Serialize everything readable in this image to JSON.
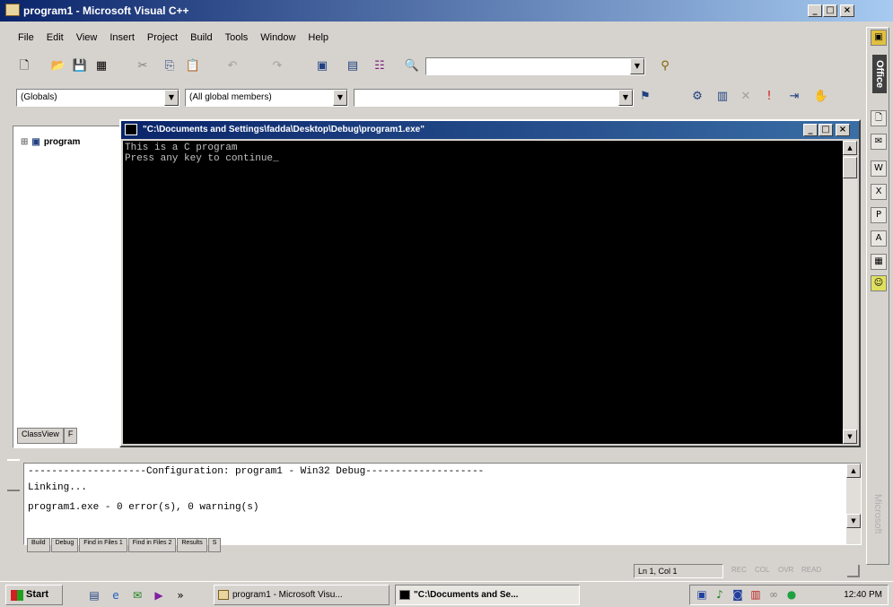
{
  "window": {
    "title": "program1 - Microsoft Visual C++",
    "controls": [
      "_",
      "□",
      "×"
    ]
  },
  "menu": [
    "File",
    "Edit",
    "View",
    "Insert",
    "Project",
    "Build",
    "Tools",
    "Window",
    "Help"
  ],
  "combos": {
    "scope": "(Globals)",
    "members": "(All global members)",
    "function": ""
  },
  "workspace": {
    "tree_root": "program",
    "tabs": [
      "ClassView",
      "F"
    ]
  },
  "console": {
    "title": "\"C:\\Documents and Settings\\fadda\\Desktop\\Debug\\program1.exe\"",
    "lines": [
      "This is a C program",
      "Press any key to continue"
    ]
  },
  "output": {
    "lines": [
      "--------------------Configuration: program1 - Win32 Debug--------------------",
      "Linking...",
      "",
      "program1.exe - 0 error(s), 0 warning(s)"
    ],
    "tabs": [
      "Build",
      "Debug",
      "Find in Files 1",
      "Find in Files 2",
      "Results",
      "S"
    ]
  },
  "status": {
    "position": "Ln 1, Col 1",
    "indicators": [
      "REC",
      "COL",
      "OVR",
      "READ"
    ]
  },
  "taskbar": {
    "start": "Start",
    "tasks": [
      "program1 - Microsoft Visu...",
      "\"C:\\Documents and Se..."
    ],
    "clock": "12:40 PM"
  },
  "officebar": {
    "label": "Office",
    "vendor": "Microsoft"
  },
  "colors": {
    "title_active": "#0a246a",
    "face": "#d6d3ce",
    "console_bg": "#000000",
    "console_fg": "#c0c0c0"
  }
}
